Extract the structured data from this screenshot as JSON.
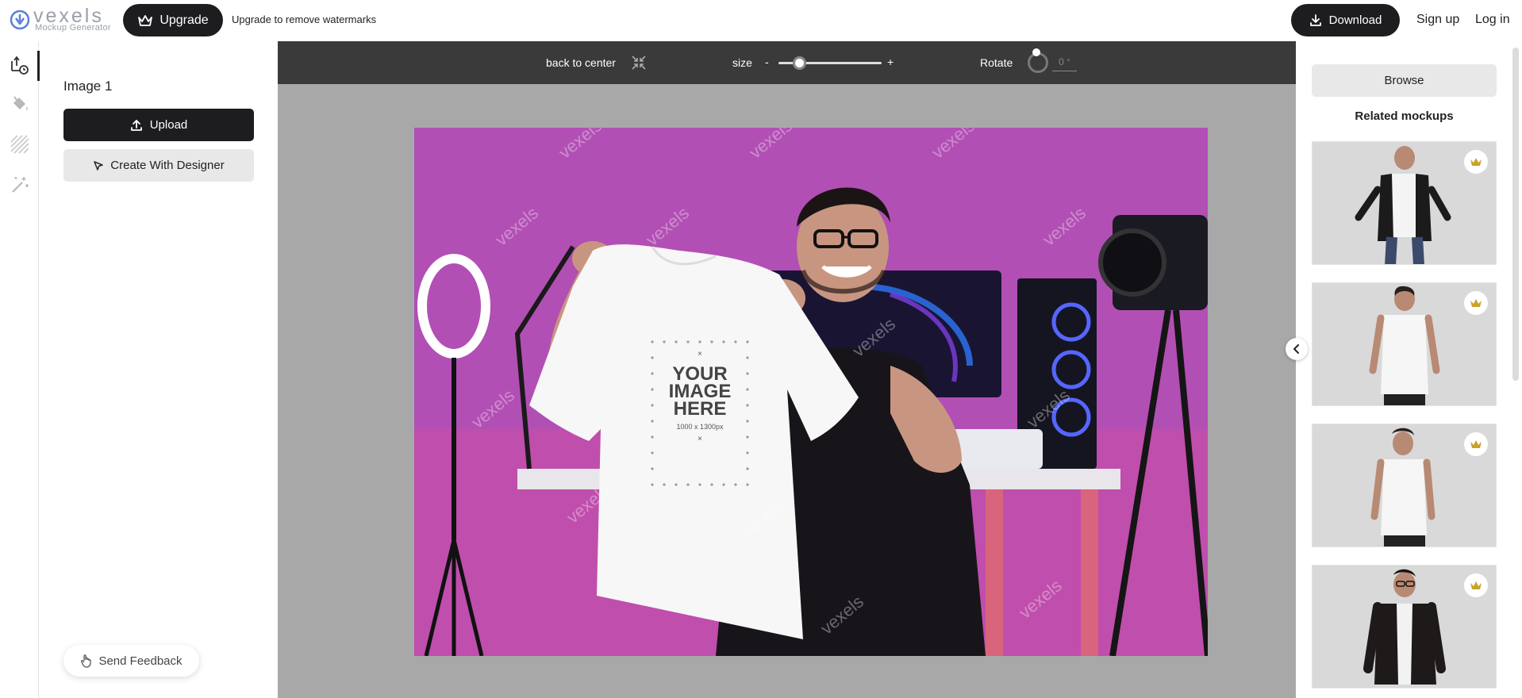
{
  "header": {
    "logo_word": "vexels",
    "logo_sub": "Mockup Generator",
    "upgrade_label": "Upgrade",
    "upgrade_note": "Upgrade to remove watermarks",
    "download_label": "Download",
    "signup_label": "Sign up",
    "login_label": "Log in"
  },
  "rail": {
    "items": [
      "image-tool",
      "color-fill-tool",
      "texture-tool",
      "magic-edit-tool"
    ]
  },
  "panel": {
    "title": "Image 1",
    "upload_label": "Upload",
    "designer_label": "Create With Designer",
    "feedback_label": "Send Feedback"
  },
  "toolbar": {
    "center_label": "back to center",
    "size_label": "size",
    "size_minus": "-",
    "size_plus": "+",
    "size_value": 0.2,
    "rotate_label": "Rotate",
    "rotate_value": "0 °"
  },
  "canvas": {
    "placeholder_line1": "YOUR",
    "placeholder_line2": "IMAGE",
    "placeholder_line3": "HERE",
    "placeholder_size": "1000 x 1300px",
    "watermark": "vexels"
  },
  "right_panel": {
    "browse_label": "Browse",
    "related_title": "Related mockups",
    "mockups": [
      {
        "name": "man-blazer-mockup",
        "premium": true
      },
      {
        "name": "man-white-tee-front-mockup",
        "premium": true
      },
      {
        "name": "man-white-tee-looking-down-mockup",
        "premium": true
      },
      {
        "name": "man-leather-jacket-mockup",
        "premium": true
      }
    ]
  },
  "colors": {
    "dark": "#1d1d1f",
    "toolbar": "#3a3a3a",
    "canvas_bg": "#a8a8a8",
    "scene_pink": "#b04cb0",
    "crown_gold": "#c9a227"
  }
}
